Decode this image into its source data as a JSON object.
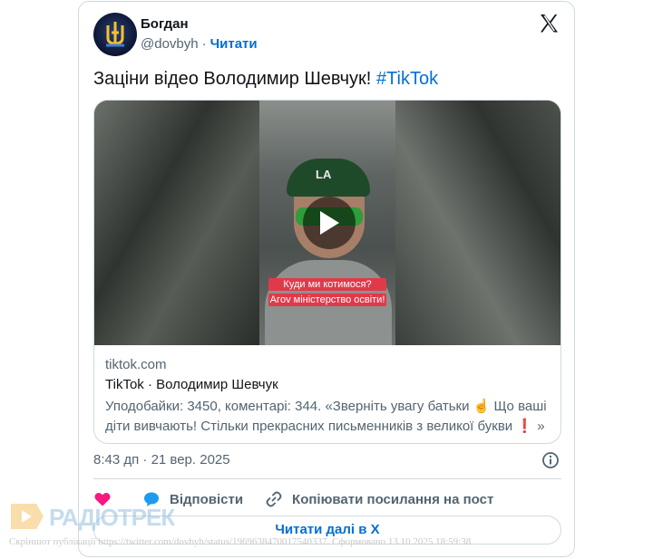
{
  "tweet": {
    "author_name": "Богдан",
    "handle": "@dovbyh",
    "separator": "·",
    "follow_label": "Читати",
    "text": "Заціни відео Володимир Шевчук!",
    "hashtag": "#TikTok"
  },
  "video": {
    "cap_logo": "LA",
    "caption_line1": "Куди ми котимося?",
    "caption_line2": "Агov міністерство освіти!"
  },
  "preview": {
    "domain": "tiktok.com",
    "title": "TikTok · Володимир Шевчук",
    "description": "Уподобайки: 3450, коментарі: 344. «Зверніть увагу батьки ☝️ Що ваші діти вивчають! Стільки прекрасних письменників з великої букви ❗ »"
  },
  "meta": {
    "timestamp": "8:43 дп · 21 вер. 2025"
  },
  "actions": {
    "reply_label": "Відповісти",
    "copy_label": "Копіювати посилання на пост",
    "read_more_label": "Читати далі в X"
  },
  "watermark": {
    "brand": "РАДІОТРЕК",
    "note": "Скріншот публікації https://twitter.com/dovbyh/status/1969638470017540337. Сформовано 13.10.2025 18:59:38"
  },
  "colors": {
    "accent": "#006fd6",
    "like": "#f91880",
    "reply": "#1d9bf0",
    "caption_bg": "#e03a4a"
  },
  "icons": [
    "x-logo-icon",
    "play-icon",
    "info-icon",
    "heart-icon",
    "reply-bubble-icon",
    "link-icon"
  ]
}
